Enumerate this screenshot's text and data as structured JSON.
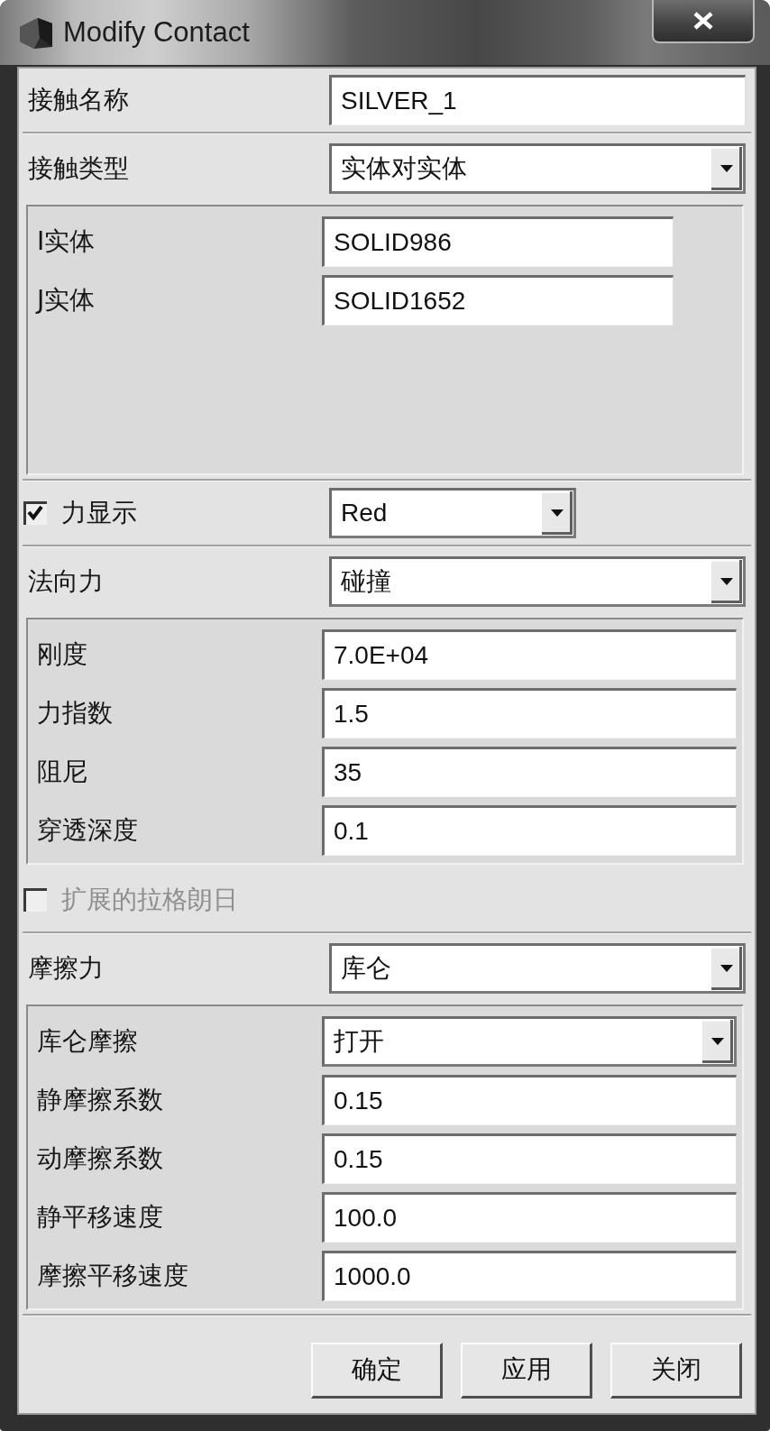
{
  "window": {
    "title": "Modify Contact"
  },
  "sections": [
    {
      "rows": [
        {
          "kind": "text",
          "label": "接触名称",
          "value": "SILVER_1"
        }
      ]
    },
    {
      "rows": [
        {
          "kind": "dropdown",
          "label": "接触类型",
          "value": "实体对实体"
        },
        {
          "kind": "panel",
          "fields": [
            {
              "kind": "text",
              "label": "I实体",
              "value": "SOLID986"
            },
            {
              "kind": "text",
              "label": "J实体",
              "value": "SOLID1652"
            }
          ]
        }
      ]
    },
    {
      "rows": [
        {
          "kind": "checkbox",
          "label": "力显示",
          "checked": true,
          "disabled": false,
          "value": "Red"
        }
      ]
    },
    {
      "rows": [
        {
          "kind": "dropdown",
          "label": "法向力",
          "value": "碰撞"
        },
        {
          "kind": "panel",
          "fields": [
            {
              "kind": "text",
              "label": "刚度",
              "value": "7.0E+04"
            },
            {
              "kind": "text",
              "label": "力指数",
              "value": "1.5"
            },
            {
              "kind": "text",
              "label": "阻尼",
              "value": "35"
            },
            {
              "kind": "text",
              "label": "穿透深度",
              "value": "0.1"
            }
          ]
        },
        {
          "kind": "checkbox",
          "label": "扩展的拉格朗日",
          "checked": false,
          "disabled": true
        }
      ]
    },
    {
      "rows": [
        {
          "kind": "dropdown",
          "label": "摩擦力",
          "value": "库仑"
        },
        {
          "kind": "panel",
          "fields": [
            {
              "kind": "dropdown",
              "label": "库仑摩擦",
              "value": "打开"
            },
            {
              "kind": "text",
              "label": "静摩擦系数",
              "value": "0.15"
            },
            {
              "kind": "text",
              "label": "动摩擦系数",
              "value": "0.15"
            },
            {
              "kind": "text",
              "label": "静平移速度",
              "value": "100.0"
            },
            {
              "kind": "text",
              "label": "摩擦平移速度",
              "value": "1000.0"
            }
          ]
        }
      ]
    }
  ],
  "buttons": [
    "确定",
    "应用",
    "关闭"
  ]
}
